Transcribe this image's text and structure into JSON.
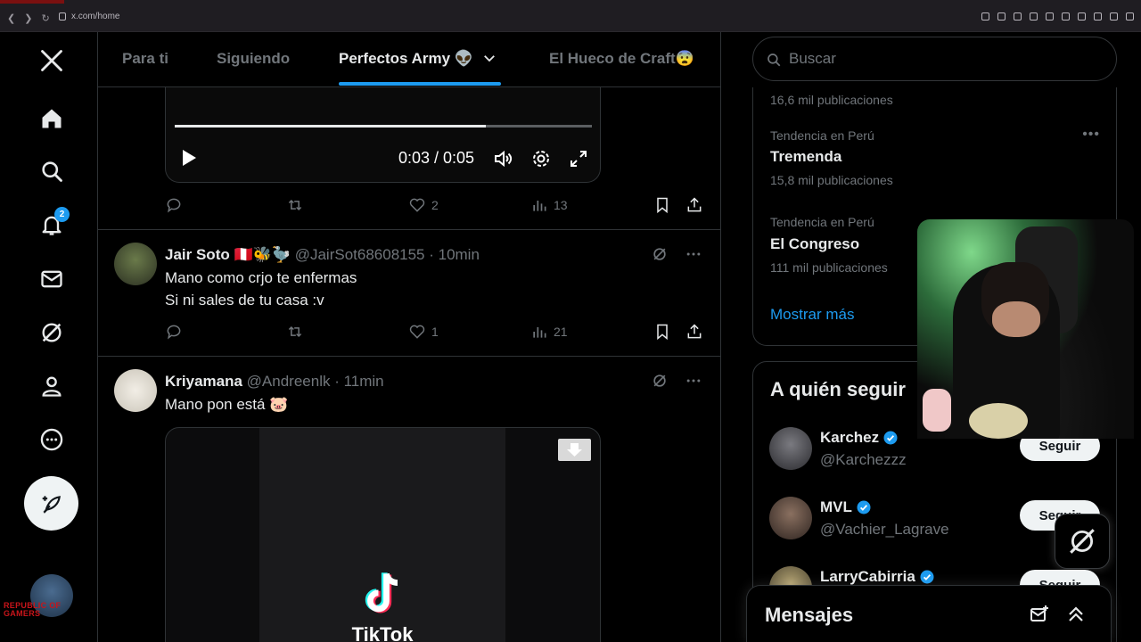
{
  "browser": {
    "url": "x.com/home"
  },
  "nav": {
    "notifications_badge": "2"
  },
  "branding": {
    "rog_line1": "REPUBLIC OF",
    "rog_line2": "GAMERS"
  },
  "tabs": [
    {
      "label": "Para ti"
    },
    {
      "label": "Siguiendo"
    },
    {
      "label": "Perfectos Army 👽"
    },
    {
      "label": "El Hueco de Craft😨"
    }
  ],
  "video": {
    "time": "0:03 / 0:05",
    "progress": 0.745
  },
  "actions_top": {
    "likes": "2",
    "views": "13"
  },
  "tweets": [
    {
      "name": "Jair Soto 🇵🇪🐝🦤",
      "meta": "@JairSot68608155 · 10min",
      "line1": "Mano como crjo te enfermas",
      "line2": "Si ni sales de tu casa :v",
      "likes": "1",
      "views": "21"
    },
    {
      "name": "Kriyamana",
      "meta": "@Andreenlk · 11min",
      "line1": "Mano pon está 🐷"
    }
  ],
  "media": {
    "brand": "TikTok"
  },
  "search": {
    "placeholder": "Buscar"
  },
  "trends": [
    {
      "count": "16,6 mil publicaciones"
    },
    {
      "context": "Tendencia en Perú",
      "title": "Tremenda",
      "count": "15,8 mil publicaciones"
    },
    {
      "context": "Tendencia en Perú",
      "title": "El Congreso",
      "count": "111 mil publicaciones"
    }
  ],
  "show_more": "Mostrar más",
  "who_to_follow": {
    "title": "A quién seguir",
    "users": [
      {
        "name": "Karchez",
        "handle": "@Karchezzz",
        "button": "Seguir"
      },
      {
        "name": "MVL",
        "handle": "@Vachier_Lagrave",
        "button": "Seguir"
      },
      {
        "name": "LarryCabirria",
        "handle": "",
        "button": "Seguir"
      }
    ]
  },
  "messages": {
    "title": "Mensajes"
  },
  "colors": {
    "accent": "#1d9bf0",
    "background": "#000000",
    "border": "#2f3336",
    "muted": "#71767b"
  }
}
